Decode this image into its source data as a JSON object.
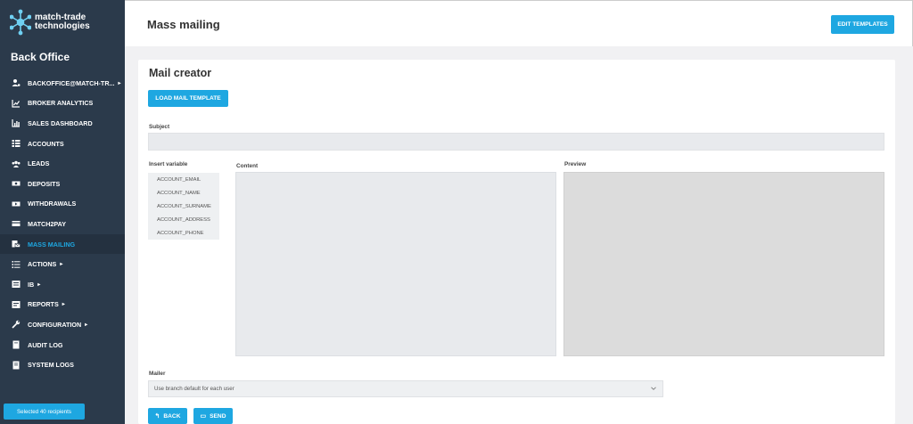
{
  "brand": {
    "line1": "match-trade",
    "line2": "technologies"
  },
  "sidebar": {
    "title": "Back Office",
    "items": [
      {
        "label": "BACKOFFICE@MATCH-TR...",
        "icon": "user-cog-icon",
        "caret": true
      },
      {
        "label": "BROKER ANALYTICS",
        "icon": "line-chart-icon"
      },
      {
        "label": "SALES DASHBOARD",
        "icon": "bar-chart-icon"
      },
      {
        "label": "ACCOUNTS",
        "icon": "list-icon"
      },
      {
        "label": "LEADS",
        "icon": "users-icon"
      },
      {
        "label": "DEPOSITS",
        "icon": "money-icon"
      },
      {
        "label": "WITHDRAWALS",
        "icon": "withdraw-icon"
      },
      {
        "label": "MATCH2PAY",
        "icon": "card-icon"
      },
      {
        "label": "MASS MAILING",
        "icon": "mail-icon",
        "active": true
      },
      {
        "label": "ACTIONS",
        "icon": "tasks-icon",
        "caret": true
      },
      {
        "label": "IB",
        "icon": "ib-icon",
        "caret": true
      },
      {
        "label": "REPORTS",
        "icon": "report-icon",
        "caret": true
      },
      {
        "label": "CONFIGURATION",
        "icon": "wrench-icon",
        "caret": true
      },
      {
        "label": "AUDIT LOG",
        "icon": "book-icon"
      },
      {
        "label": "SYSTEM LOGS",
        "icon": "logbook-icon"
      }
    ],
    "selected_badge": "Selected 40 recipients"
  },
  "header": {
    "title": "Mass mailing",
    "edit_templates": "EDIT TEMPLATES"
  },
  "card": {
    "title": "Mail creator",
    "load_template": "LOAD MAIL TEMPLATE",
    "subject_label": "Subject",
    "subject_value": "",
    "insert_variable_label": "Insert variable",
    "variables": [
      "ACCOUNT_EMAIL",
      "ACCOUNT_NAME",
      "ACCOUNT_SURNAME",
      "ACCOUNT_ADDRESS",
      "ACCOUNT_PHONE"
    ],
    "content_label": "Content",
    "preview_label": "Preview",
    "mailer_label": "Mailer",
    "mailer_value": "Use branch default for each user",
    "back": "BACK",
    "send": "SEND"
  },
  "colors": {
    "accent": "#1ea7e1",
    "sidebar_bg": "#2b3a4b"
  }
}
